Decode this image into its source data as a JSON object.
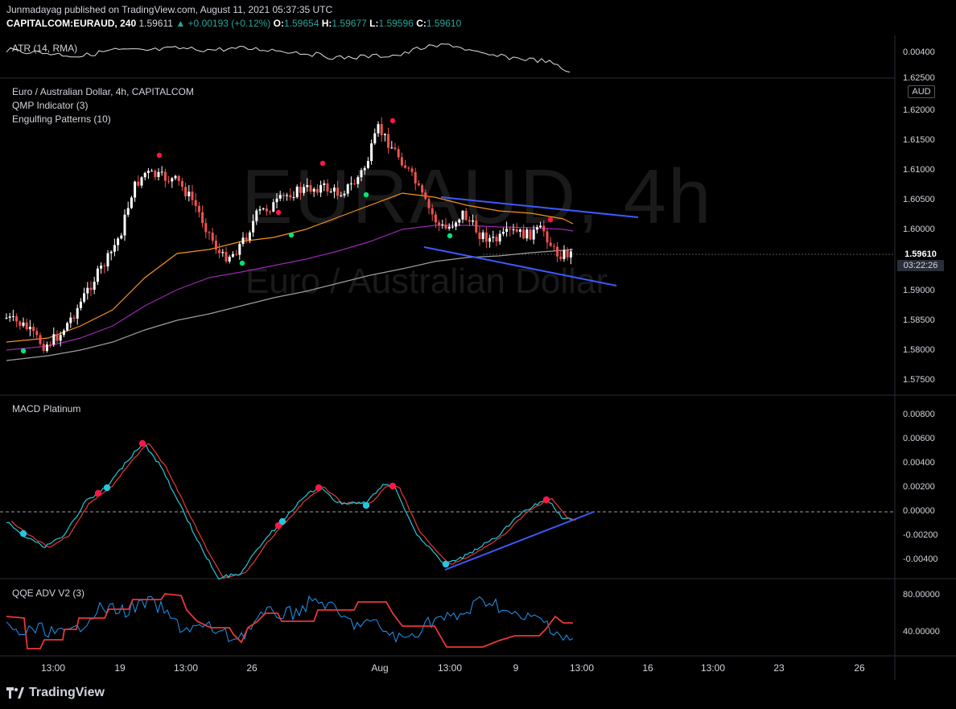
{
  "header": {
    "publish_line": "Junmadayag published on TradingView.com, August 11, 2021 05:37:35 UTC",
    "symbol": "CAPITALCOM:EURAUD, 240",
    "last": "1.59611",
    "change": "+0.00193 (+0.12%)",
    "o_label": "O:",
    "o_value": "1.59654",
    "h_label": "H:",
    "h_value": "1.59677",
    "l_label": "L:",
    "l_value": "1.59596",
    "c_label": "C:",
    "c_value": "1.59610"
  },
  "panes": {
    "atr": {
      "label": "ATR (14, RMA)",
      "axis": [
        "0.00400",
        "1.62500"
      ]
    },
    "main": {
      "title": "Euro / Australian Dollar, 4h, CAPITALCOM",
      "indicator1": "QMP Indicator (3)",
      "indicator2": "Engulfing Patterns (10)",
      "axis": [
        "1.62000",
        "1.61500",
        "1.61000",
        "1.60500",
        "1.60000",
        "1.59000",
        "1.58500",
        "1.58000",
        "1.57500"
      ],
      "currency": "AUD",
      "price_tag": "1.59610",
      "countdown": "03:22:26",
      "watermark_symbol": "EURAUD, 4h",
      "watermark_name": "Euro / Australian Dollar"
    },
    "macd": {
      "label": "MACD Platinum",
      "axis": [
        "0.00800",
        "0.00600",
        "0.00400",
        "0.00200",
        "0.00000",
        "-0.00200",
        "-0.00400"
      ]
    },
    "qqe": {
      "label": "QQE ADV V2 (3)",
      "axis": [
        "80.00000",
        "40.00000"
      ]
    }
  },
  "xaxis": [
    "13:00",
    "19",
    "13:00",
    "26",
    "Aug",
    "13:00",
    "9",
    "13:00",
    "16",
    "13:00",
    "23",
    "26"
  ],
  "footer": {
    "brand": "TradingView"
  },
  "colors": {
    "up": "#ffffff",
    "down": "#ef5350",
    "ema_fast": "#f7931a",
    "ema_mid": "#9c27b0",
    "ema_slow": "#9e9e9e",
    "trendline": "#3d5afe",
    "macd_line": "#26c6da",
    "signal_line": "#e53935",
    "qqe_fast": "#2196f3",
    "qqe_slow": "#e53935",
    "dot_green": "#00e676",
    "dot_red": "#ff1744"
  }
}
